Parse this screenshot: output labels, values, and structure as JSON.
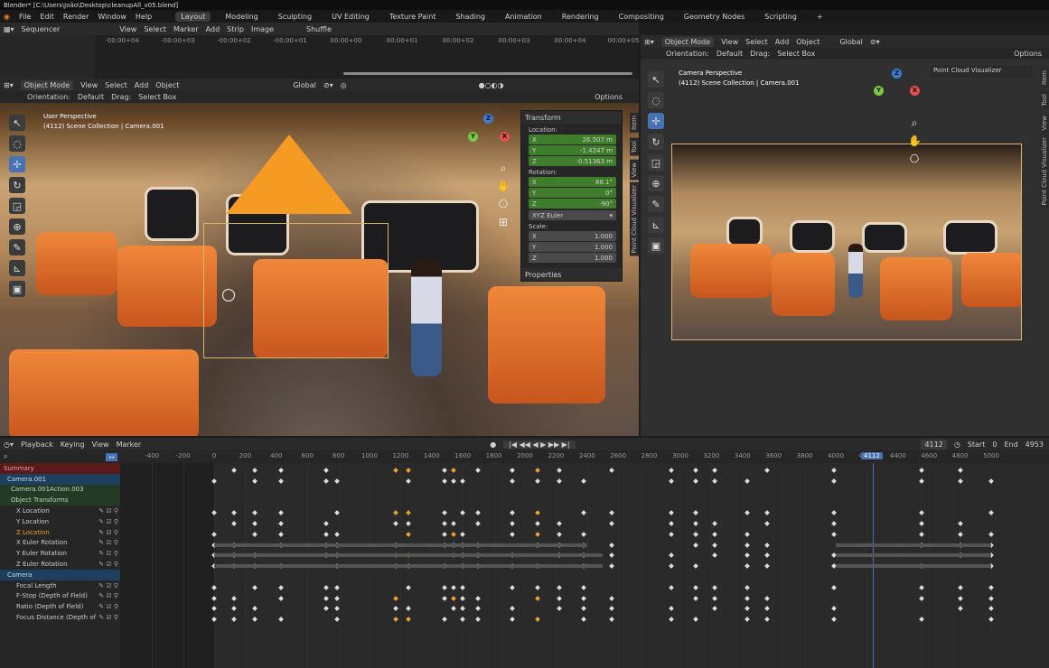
{
  "window": {
    "title": "Blender* [C:\\Users\\João\\Desktop\\cleanupAll_v05.blend]"
  },
  "menu": [
    "File",
    "Edit",
    "Render",
    "Window",
    "Help"
  ],
  "workspaces": [
    "Layout",
    "Modeling",
    "Sculpting",
    "UV Editing",
    "Texture Paint",
    "Shading",
    "Animation",
    "Rendering",
    "Compositing",
    "Geometry Nodes",
    "Scripting"
  ],
  "workspace_add": "+",
  "sequencer": {
    "editor": "Sequencer",
    "menus": [
      "View",
      "Select",
      "Marker",
      "Add",
      "Strip",
      "Image"
    ],
    "shuffle": "Shuffle",
    "times": [
      "-00:00+04",
      "-00:00+03",
      "-00:00+02",
      "-00:00+01",
      "00:00+00",
      "00:00+01",
      "00:00+02",
      "00:00+03",
      "00:00+04",
      "00:00+05"
    ]
  },
  "viewport_left": {
    "mode": "Object Mode",
    "menus": [
      "View",
      "Select",
      "Add",
      "Object"
    ],
    "transform": "Global",
    "orientation_label": "Orientation:",
    "orientation": "Default",
    "drag_label": "Drag:",
    "drag": "Select Box",
    "options": "Options",
    "view_name": "User Perspective",
    "collection": "(4112) Scene Collection | Camera.001"
  },
  "viewport_right": {
    "mode": "Object Mode",
    "menus": [
      "View",
      "Select",
      "Add",
      "Object"
    ],
    "transform": "Global",
    "orientation_label": "Orientation:",
    "orientation": "Default",
    "drag_label": "Drag:",
    "drag": "Select Box",
    "options": "Options",
    "view_name": "Camera Perspective",
    "collection": "(4112) Scene Collection | Camera.001",
    "panel": "Point Cloud Visualizer"
  },
  "transform_panel": {
    "title": "Transform",
    "location_label": "Location:",
    "location": [
      {
        "axis": "X",
        "value": "26.507 m"
      },
      {
        "axis": "Y",
        "value": "-1.4247 m"
      },
      {
        "axis": "Z",
        "value": "-0.51363 m"
      }
    ],
    "rotation_label": "Rotation:",
    "rotation": [
      {
        "axis": "X",
        "value": "88.1°"
      },
      {
        "axis": "Y",
        "value": "0°"
      },
      {
        "axis": "Z",
        "value": "-90°"
      }
    ],
    "rotation_mode": "XYZ Euler",
    "scale_label": "Scale:",
    "scale": [
      {
        "axis": "X",
        "value": "1.000"
      },
      {
        "axis": "Y",
        "value": "1.000"
      },
      {
        "axis": "Z",
        "value": "1.000"
      }
    ],
    "properties": "Properties"
  },
  "side_tabs_left": [
    "Item",
    "Tool",
    "View",
    "Point Cloud Visualizer"
  ],
  "side_tabs_right": [
    "Item",
    "Tool",
    "View",
    "Point Cloud Visualizer"
  ],
  "timeline": {
    "menus": [
      "Playback",
      "Keying",
      "View",
      "Marker"
    ],
    "current_frame": "4112",
    "start_label": "Start",
    "start": "0",
    "end_label": "End",
    "end": "4953"
  },
  "frames": [
    "-400",
    "-200",
    "0",
    "200",
    "400",
    "600",
    "800",
    "1000",
    "1200",
    "1400",
    "1600",
    "1800",
    "2000",
    "2200",
    "2400",
    "2600",
    "2800",
    "3000",
    "3200",
    "3400",
    "3600",
    "3800",
    "4000",
    "4112",
    "4200",
    "4400",
    "4600",
    "4800",
    "5000"
  ],
  "channels": [
    {
      "label": "Summary",
      "kind": "sum"
    },
    {
      "label": "Camera.001",
      "kind": "obj"
    },
    {
      "label": "Camera.001Action.003",
      "kind": "grp"
    },
    {
      "label": "Object Transforms",
      "kind": "grp"
    },
    {
      "label": "X Location",
      "kind": "ch"
    },
    {
      "label": "Y Location",
      "kind": "ch"
    },
    {
      "label": "Z Location",
      "kind": "chsel"
    },
    {
      "label": "X Euler Rotation",
      "kind": "ch"
    },
    {
      "label": "Y Euler Rotation",
      "kind": "ch"
    },
    {
      "label": "Z Euler Rotation",
      "kind": "ch"
    },
    {
      "label": "Camera",
      "kind": "obj"
    },
    {
      "label": "Focal Length",
      "kind": "ch"
    },
    {
      "label": "F-Stop (Depth of Field)",
      "kind": "ch"
    },
    {
      "label": "Ratio (Depth of Field)",
      "kind": "ch"
    },
    {
      "label": "Focus Distance (Depth of",
      "kind": "ch"
    }
  ],
  "colors": {
    "accent": "#4772b3",
    "keyframe": "#dddddd",
    "keyframe_selected": "#f0a030",
    "summary": "#5a1a1a"
  }
}
